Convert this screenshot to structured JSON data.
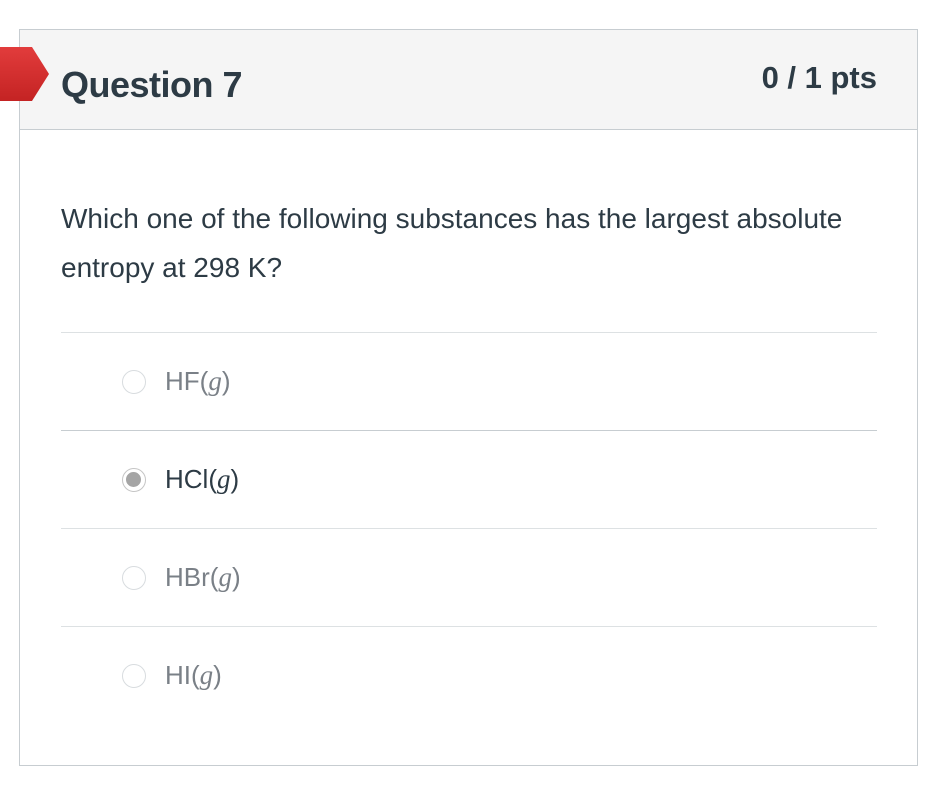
{
  "question": {
    "title": "Question 7",
    "points": "0 / 1 pts",
    "text": "Which one of the following substances has the largest absolute entropy at 298 K?"
  },
  "answers": [
    {
      "formula": "HF",
      "state": "g",
      "paren_open": "(",
      "paren_close": ")",
      "selected": false
    },
    {
      "formula": "HCl",
      "state": "g",
      "paren_open": "(",
      "paren_close": ")",
      "selected": true
    },
    {
      "formula": "HBr",
      "state": "g",
      "paren_open": "(",
      "paren_close": ")",
      "selected": false
    },
    {
      "formula": "HI",
      "state": "g",
      "paren_open": "(",
      "paren_close": ")",
      "selected": false
    }
  ],
  "colors": {
    "flag": "#d52b2b",
    "text": "#2d3b45",
    "header_bg": "#f5f5f5",
    "border": "#c7cdd1",
    "radio_selected": "#a5a5a5"
  },
  "icons": {
    "flag": "incorrect-flag-icon"
  }
}
